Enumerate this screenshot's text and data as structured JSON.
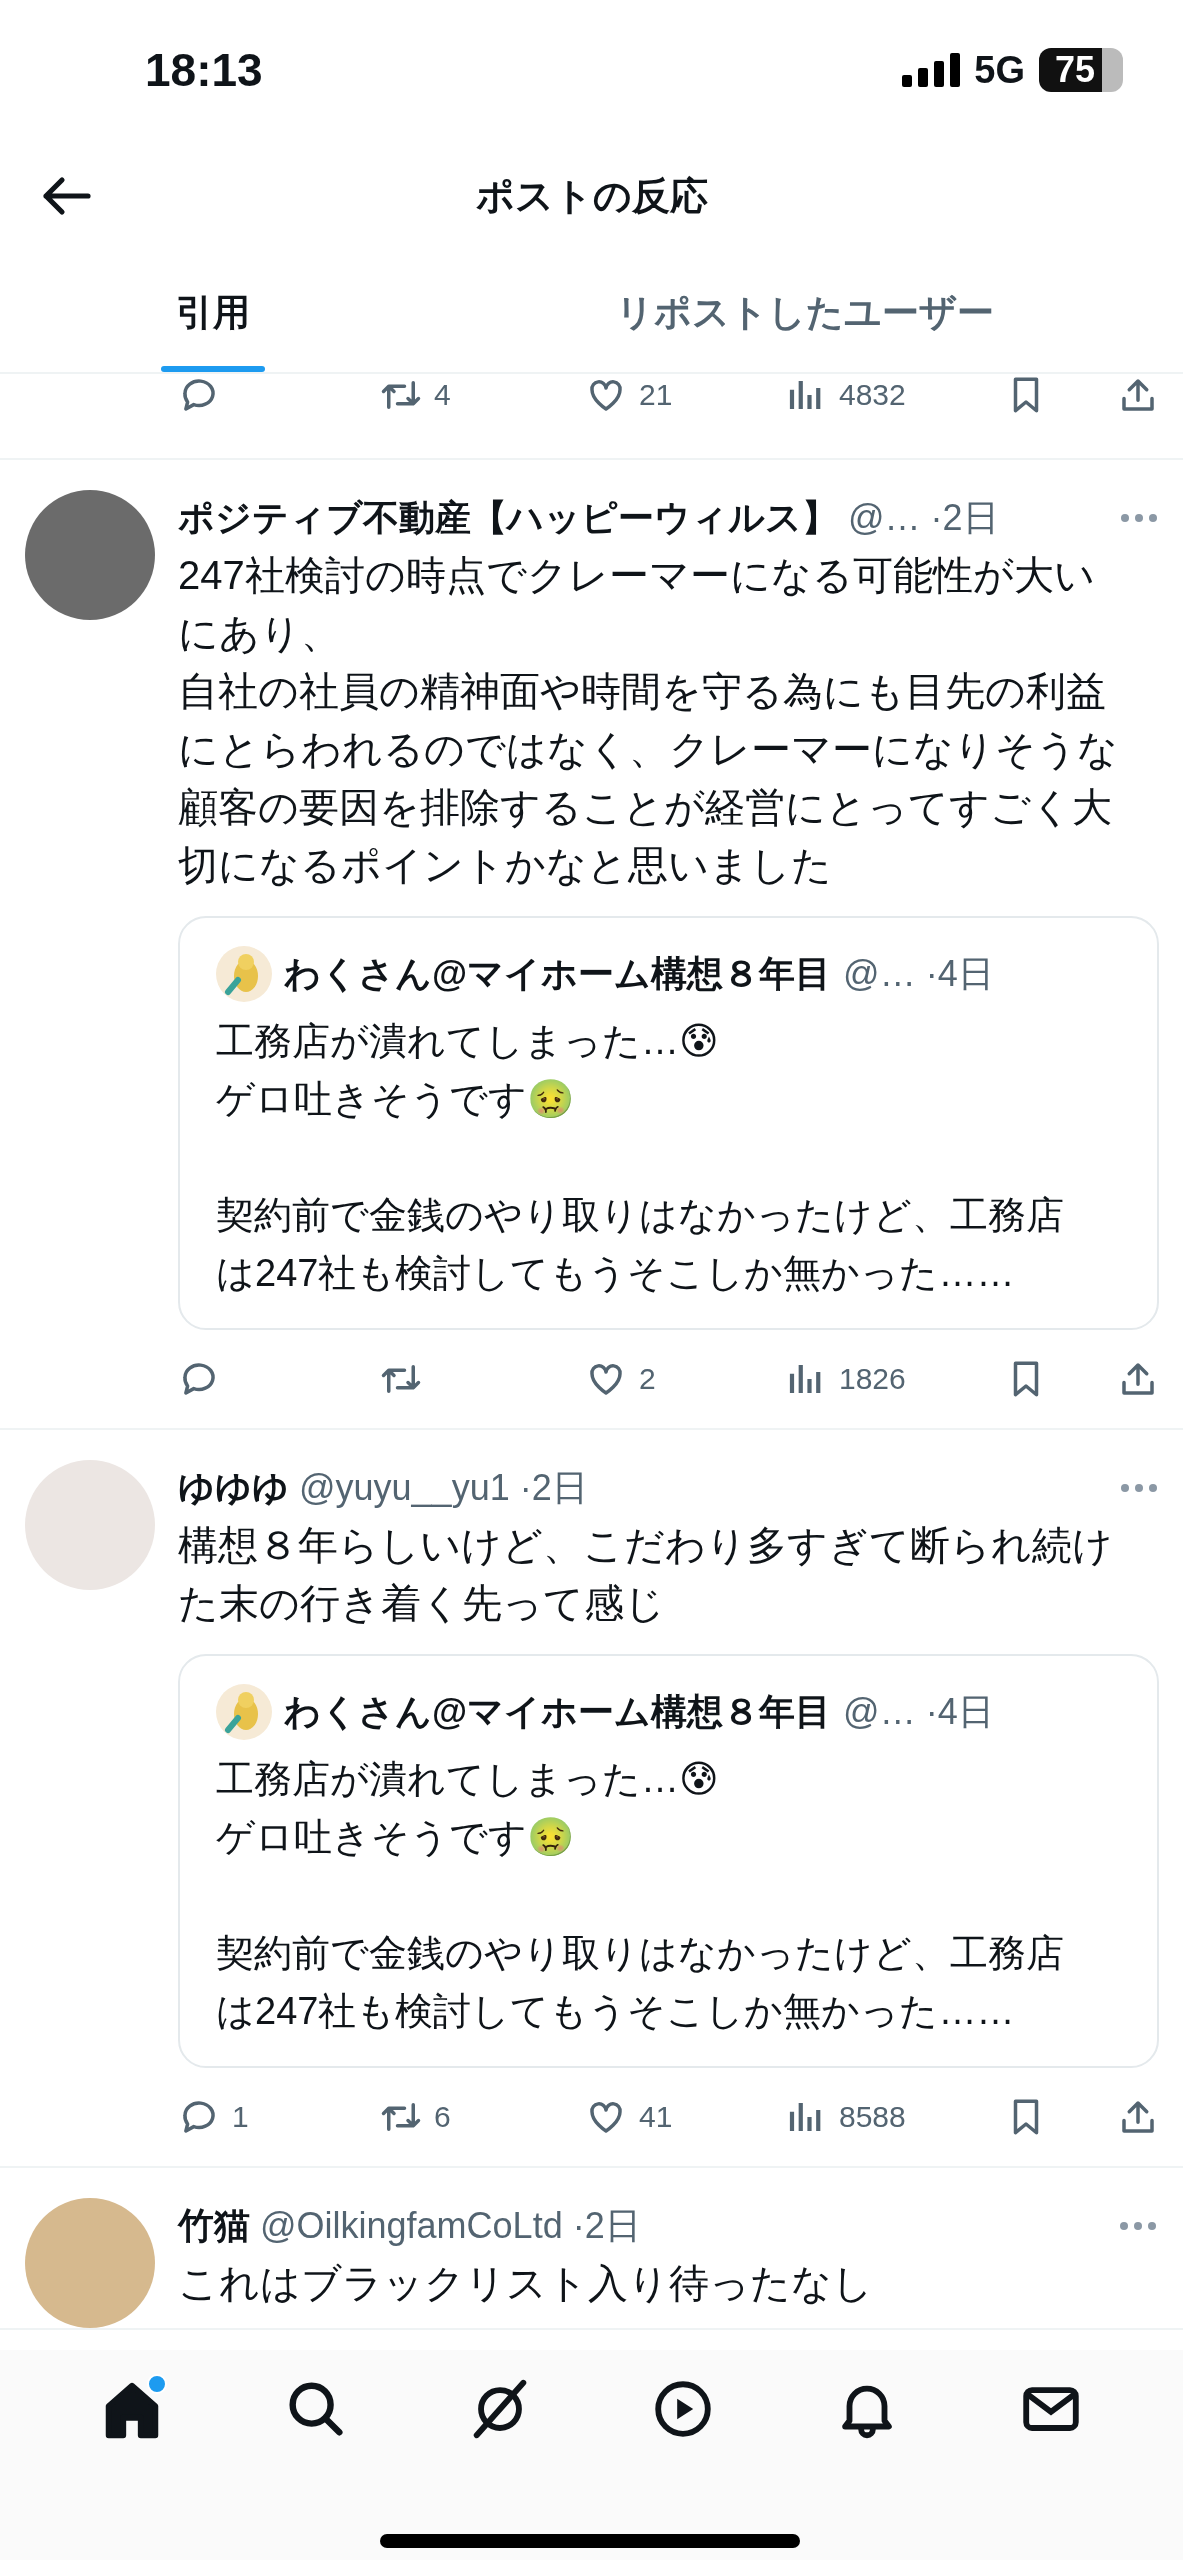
{
  "status_bar": {
    "time": "18:13",
    "network": "5G",
    "battery": "75"
  },
  "header": {
    "title": "ポストの反応"
  },
  "tabs": [
    {
      "label": "引用",
      "selected": true
    },
    {
      "label": "リポストしたユーザー",
      "selected": false
    }
  ],
  "previous_post_actions": {
    "retweets": "4",
    "likes": "21",
    "views": "4832"
  },
  "posts": [
    {
      "name": "ポジティブ不動産【ハッピーウィルス】",
      "handle": "@…",
      "time": "·2日",
      "text": "247社検討の時点でクレーマーになる可能性が大いにあり、",
      "text_2": "自社の社員の精神面や時間を守る為にも目先の利益にとらわれるのではなく、クレーマーになりそうな顧客の要因を排除することが経営にとってすごく大切になるポイントかなと思いました",
      "quote": {
        "name": "わくさん@マイホーム構想８年目",
        "handle": "@…",
        "time": "·4日",
        "text": "工務店が潰れてしまった…😰\nゲロ吐きそうです🤢\n\n契約前で金銭のやり取りはなかったけど、工務店は247社も検討してもうそこしか無かった……"
      },
      "actions": {
        "likes": "2",
        "views": "1826"
      }
    },
    {
      "name": "ゆゆゆ",
      "handle": "@yuyu__yu1",
      "time": "·2日",
      "text": "構想８年らしいけど、こだわり多すぎて断られ続けた末の行き着く先って感じ",
      "quote": {
        "name": "わくさん@マイホーム構想８年目",
        "handle": "@…",
        "time": "·4日",
        "text": "工務店が潰れてしまった…😰\nゲロ吐きそうです🤢\n\n契約前で金銭のやり取りはなかったけど、工務店は247社も検討してもうそこしか無かった……"
      },
      "actions": {
        "replies": "1",
        "retweets": "6",
        "likes": "41",
        "views": "8588"
      }
    },
    {
      "name": "竹猫",
      "handle": "@OilkingfamCoLtd",
      "time": "·2日",
      "text": "これはブラックリスト入り待ったなし"
    }
  ],
  "bottom_nav": [
    {
      "kind": "home",
      "selected": true,
      "dot": true
    },
    {
      "kind": "search",
      "selected": false,
      "dot": false
    },
    {
      "kind": "grok",
      "selected": false,
      "dot": false
    },
    {
      "kind": "play",
      "selected": false,
      "dot": false
    },
    {
      "kind": "bell",
      "selected": false,
      "dot": false
    },
    {
      "kind": "mail",
      "selected": false,
      "dot": false
    }
  ]
}
